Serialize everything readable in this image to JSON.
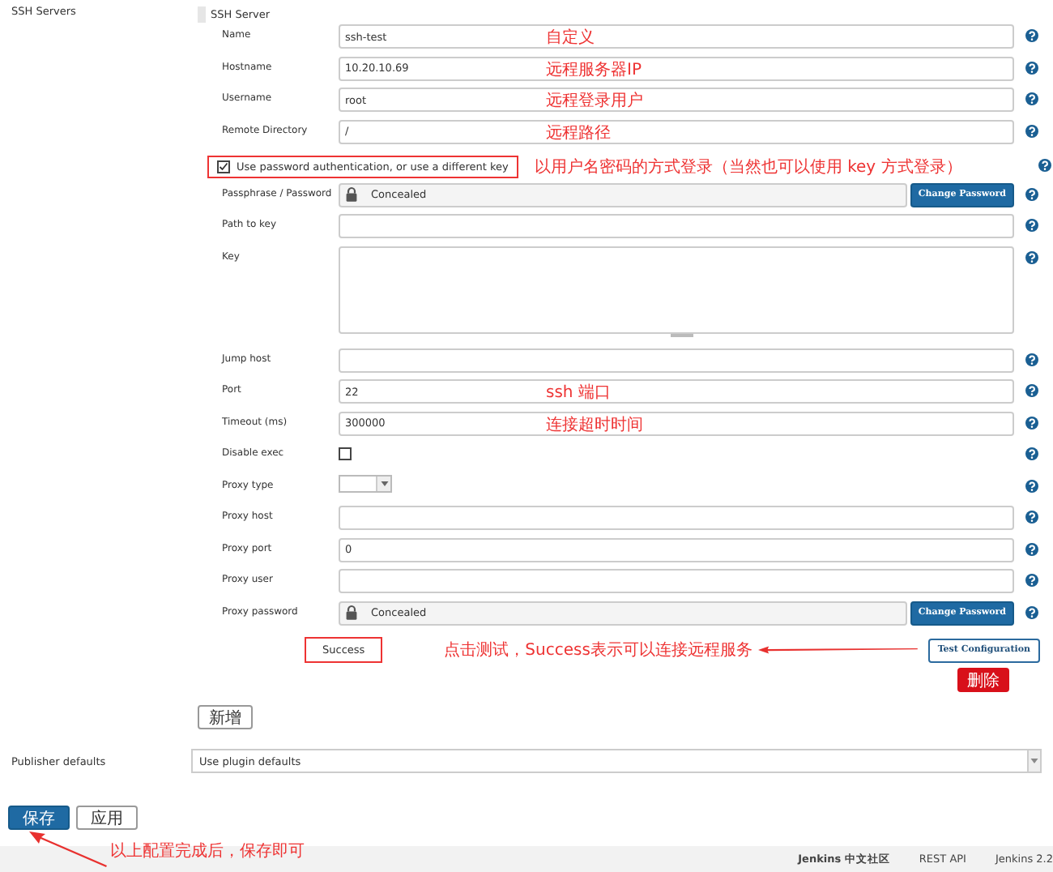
{
  "section_label": "SSH Servers",
  "server": {
    "title": "SSH Server",
    "fields": [
      {
        "kind": "text",
        "label": "Name",
        "value": "ssh-test",
        "note": "自定义"
      },
      {
        "kind": "text",
        "label": "Hostname",
        "value": "10.20.10.69",
        "note": "远程服务器IP"
      },
      {
        "kind": "text",
        "label": "Username",
        "value": "root",
        "note": "远程登录用户"
      },
      {
        "kind": "text",
        "label": "Remote Directory",
        "value": "/",
        "note": "远程路径"
      },
      {
        "kind": "toggle",
        "label": "Use password authentication, or use a different key",
        "checked": true,
        "highlighted": true,
        "note": "以用户名密码的方式登录（当然也可以使用 key 方式登录）"
      },
      {
        "kind": "password",
        "label": "Passphrase / Password",
        "value": "Concealed",
        "button": "Change Password"
      },
      {
        "kind": "text",
        "label": "Path to key"
      },
      {
        "kind": "textarea",
        "label": "Key"
      },
      {
        "kind": "text",
        "label": "Jump host"
      },
      {
        "kind": "text",
        "label": "Port",
        "value": "22",
        "note": "ssh  端口"
      },
      {
        "kind": "text",
        "label": "Timeout (ms)",
        "value": "300000",
        "note": "连接超时时间"
      },
      {
        "kind": "checkbox",
        "label": "Disable exec",
        "checked": false
      },
      {
        "kind": "select",
        "label": "Proxy type"
      },
      {
        "kind": "text",
        "label": "Proxy host"
      },
      {
        "kind": "text",
        "label": "Proxy port",
        "value": "0"
      },
      {
        "kind": "text",
        "label": "Proxy user"
      },
      {
        "kind": "password",
        "label": "Proxy password",
        "value": "Concealed",
        "button": "Change Password"
      }
    ],
    "test_result": {
      "text": "Success",
      "highlighted": true
    },
    "test_note": "点击测试，Success表示可以连接远程服务",
    "test_button": "Test Configuration",
    "delete_button": "删除"
  },
  "add_button": "新增",
  "publisher_defaults": {
    "label": "Publisher defaults",
    "value": "Use plugin defaults"
  },
  "save_button": "保存",
  "apply_button": "应用",
  "save_note": "以上配置完成后，保存即可",
  "footer": [
    "Jenkins 中文社区",
    "REST API",
    "Jenkins 2.2"
  ]
}
